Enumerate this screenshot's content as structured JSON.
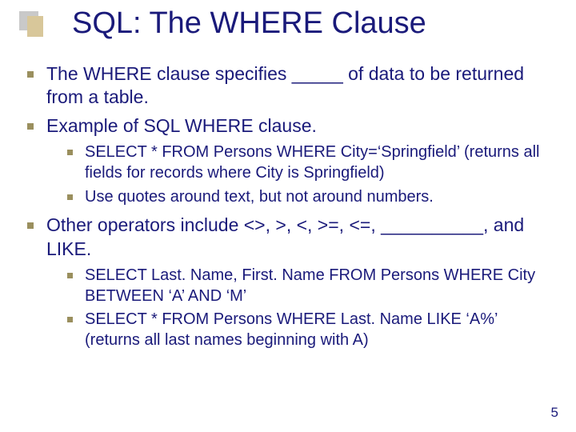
{
  "title": "SQL: The WHERE Clause",
  "points": {
    "p1": "The WHERE clause specifies _____ of data to be returned from a table.",
    "p2": "Example of SQL WHERE clause.",
    "p2a": "SELECT * FROM Persons WHERE City=‘Springfield’ (returns all fields for records where City is Springfield)",
    "p2b": "Use quotes around text, but not around numbers.",
    "p3": "Other operators include <>, >, <, >=, <=, __________, and LIKE.",
    "p3a": "SELECT Last. Name, First. Name FROM Persons WHERE City BETWEEN ‘A’ AND ‘M’",
    "p3b": "SELECT * FROM Persons WHERE Last. Name LIKE ‘A%’ (returns all last names beginning with A)"
  },
  "page_number": "5"
}
